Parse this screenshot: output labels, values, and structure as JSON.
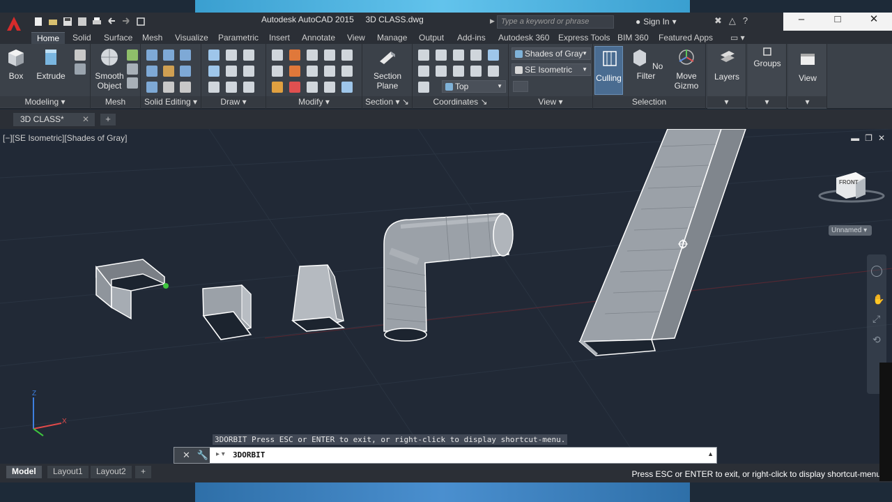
{
  "title": {
    "app": "Autodesk AutoCAD 2015",
    "file": "3D CLASS.dwg",
    "search_placeholder": "Type a keyword or phrase",
    "signin": "Sign In"
  },
  "window_controls": [
    "–",
    "□",
    "✕"
  ],
  "ribbon_tabs": [
    "Home",
    "Solid",
    "Surface",
    "Mesh",
    "Visualize",
    "Parametric",
    "Insert",
    "Annotate",
    "View",
    "Manage",
    "Output",
    "Add-ins",
    "Autodesk 360",
    "Express Tools",
    "BIM 360",
    "Featured Apps"
  ],
  "ribbon": {
    "box": "Box",
    "extrude": "Extrude",
    "smooth_object_1": "Smooth",
    "smooth_object_2": "Object",
    "section_plane_1": "Section",
    "section_plane_2": "Plane",
    "visual_style": "Shades of Gray",
    "view_direction": "SE Isometric",
    "ucs_view": "Top",
    "culling": "Culling",
    "no_filter": "No Filter",
    "move_gizmo_1": "Move",
    "move_gizmo_2": "Gizmo",
    "layers": "Layers",
    "groups": "Groups",
    "view": "View",
    "panels": {
      "modeling": "Modeling",
      "mesh": "Mesh",
      "solid_editing": "Solid Editing",
      "draw": "Draw",
      "modify": "Modify",
      "section": "Section",
      "coordinates": "Coordinates",
      "view": "View",
      "selection": "Selection"
    }
  },
  "file_tab": "3D CLASS*",
  "viewport": {
    "label": "[−][SE Isometric][Shades of Gray]",
    "viewcube_face": "FRONT",
    "unnamed": "Unnamed",
    "command_hint": "3DORBIT Press ESC or ENTER to exit, or right-click to display shortcut-menu."
  },
  "command_line": {
    "text": "3DORBIT"
  },
  "layout_tabs": [
    "Model",
    "Layout1",
    "Layout2"
  ],
  "status_message": "Press ESC or ENTER to exit, or right-click to display shortcut-menu",
  "colors": {
    "viewport_bg": "#212936",
    "ribbon_bg": "#3b4149",
    "accent": "#4a6c91"
  }
}
